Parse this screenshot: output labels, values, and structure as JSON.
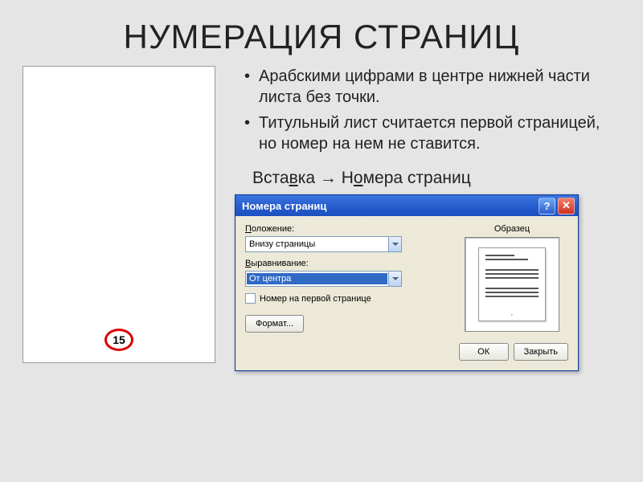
{
  "title": "НУМЕРАЦИЯ СТРАНИЦ",
  "page_sample": {
    "number": "15"
  },
  "bullets": [
    "Арабскими цифрами в центре нижней части листа без точки.",
    "Титульный лист считается первой страницей, но номер на нем не ставится."
  ],
  "menu_path": {
    "part1_pre": "Вста",
    "part1_u": "в",
    "part1_post": "ка",
    "arrow": "→",
    "part2_pre": "Н",
    "part2_u": "о",
    "part2_post": "мера страниц"
  },
  "dialog": {
    "title": "Номера страниц",
    "help": "?",
    "close": "✕",
    "position_label_u": "П",
    "position_label_rest": "оложение:",
    "position_value": "Внизу страницы",
    "align_label_u": "В",
    "align_label_rest": "ыравнивание:",
    "align_value": "От центра",
    "checkbox_u": "Н",
    "checkbox_rest": "омер на первой странице",
    "format_btn_u": "Ф",
    "format_btn_rest": "ормат...",
    "preview_label": "Образец",
    "ok": "ОК",
    "cancel": "Закрыть"
  }
}
